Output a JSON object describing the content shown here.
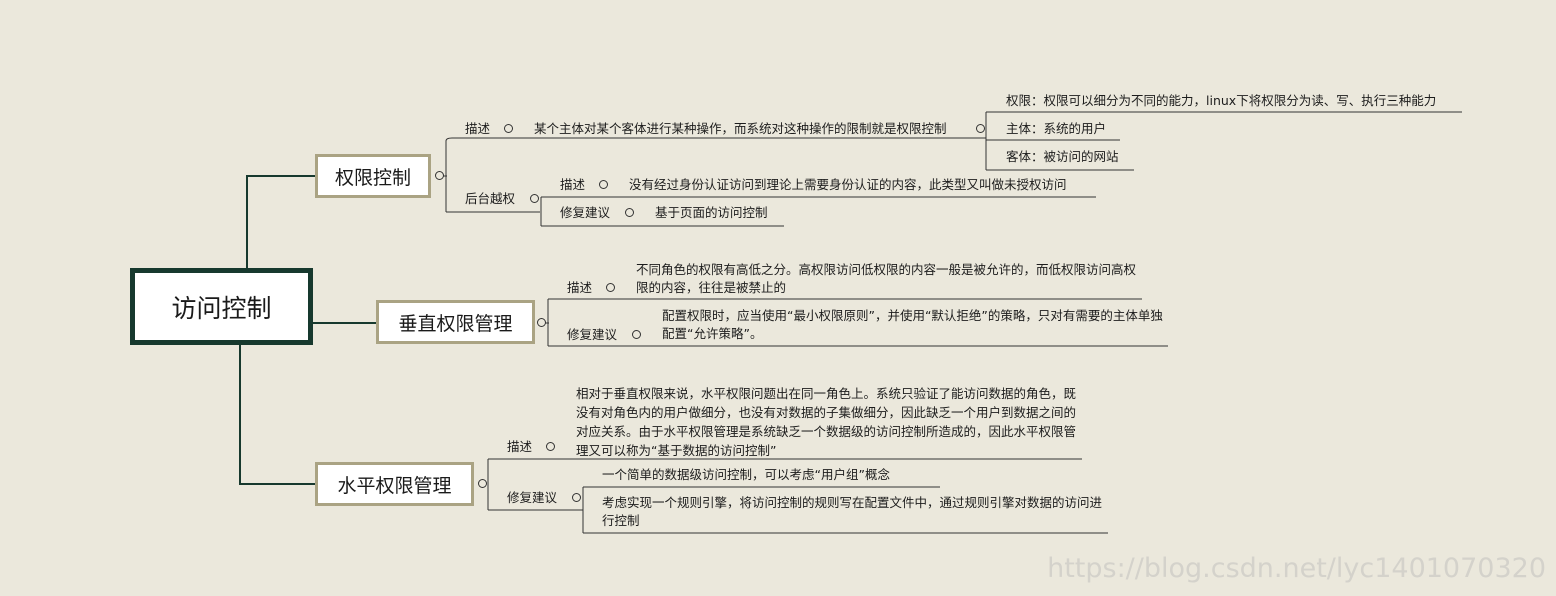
{
  "root": {
    "label": "访问控制"
  },
  "branches": [
    {
      "label": "权限控制",
      "children": [
        {
          "label": "描述",
          "text": "某个主体对某个客体进行某种操作，而系统对这种操作的限制就是权限控制",
          "sub": [
            "权限：权限可以细分为不同的能力，linux下将权限分为读、写、执行三种能力",
            "主体：系统的用户",
            "客体：被访问的网站"
          ]
        },
        {
          "label": "后台越权",
          "children": [
            {
              "label": "描述",
              "text": "没有经过身份认证访问到理论上需要身份认证的内容，此类型又叫做未授权访问"
            },
            {
              "label": "修复建议",
              "text": "基于页面的访问控制"
            }
          ]
        }
      ]
    },
    {
      "label": "垂直权限管理",
      "children": [
        {
          "label": "描述",
          "text": "不同角色的权限有高低之分。高权限访问低权限的内容一般是被允许的，而低权限访问高权限的内容，往往是被禁止的"
        },
        {
          "label": "修复建议",
          "text": "配置权限时，应当使用“最小权限原则”，并使用“默认拒绝”的策略，只对有需要的主体单独配置“允许策略”。"
        }
      ]
    },
    {
      "label": "水平权限管理",
      "children": [
        {
          "label": "描述",
          "text": "相对于垂直权限来说，水平权限问题出在同一角色上。系统只验证了能访问数据的角色，既没有对角色内的用户做细分，也没有对数据的子集做细分，因此缺乏一个用户到数据之间的对应关系。由于水平权限管理是系统缺乏一个数据级的访问控制所造成的，因此水平权限管理又可以称为“基于数据的访问控制”"
        },
        {
          "label": "修复建议",
          "items": [
            "一个简单的数据级访问控制，可以考虑“用户组”概念",
            "考虑实现一个规则引擎，将访问控制的规则写在配置文件中，通过规则引擎对数据的访问进行控制"
          ]
        }
      ]
    }
  ],
  "watermark": "https://blog.csdn.net/lyc1401070320",
  "colors": {
    "background": "#ebe8dc",
    "root_border": "#17392e",
    "node_border": "#aaa383",
    "line": "#17392e"
  }
}
